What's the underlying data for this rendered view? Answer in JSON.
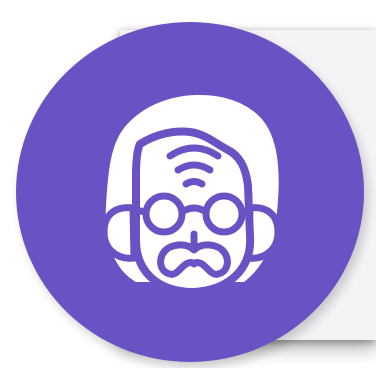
{
  "colors": {
    "accent": "#6b52c4",
    "icon_fill": "#ffffff",
    "card": "#f4f4f6"
  },
  "icon": {
    "name": "old-man-with-glasses-and-mustache-icon"
  }
}
